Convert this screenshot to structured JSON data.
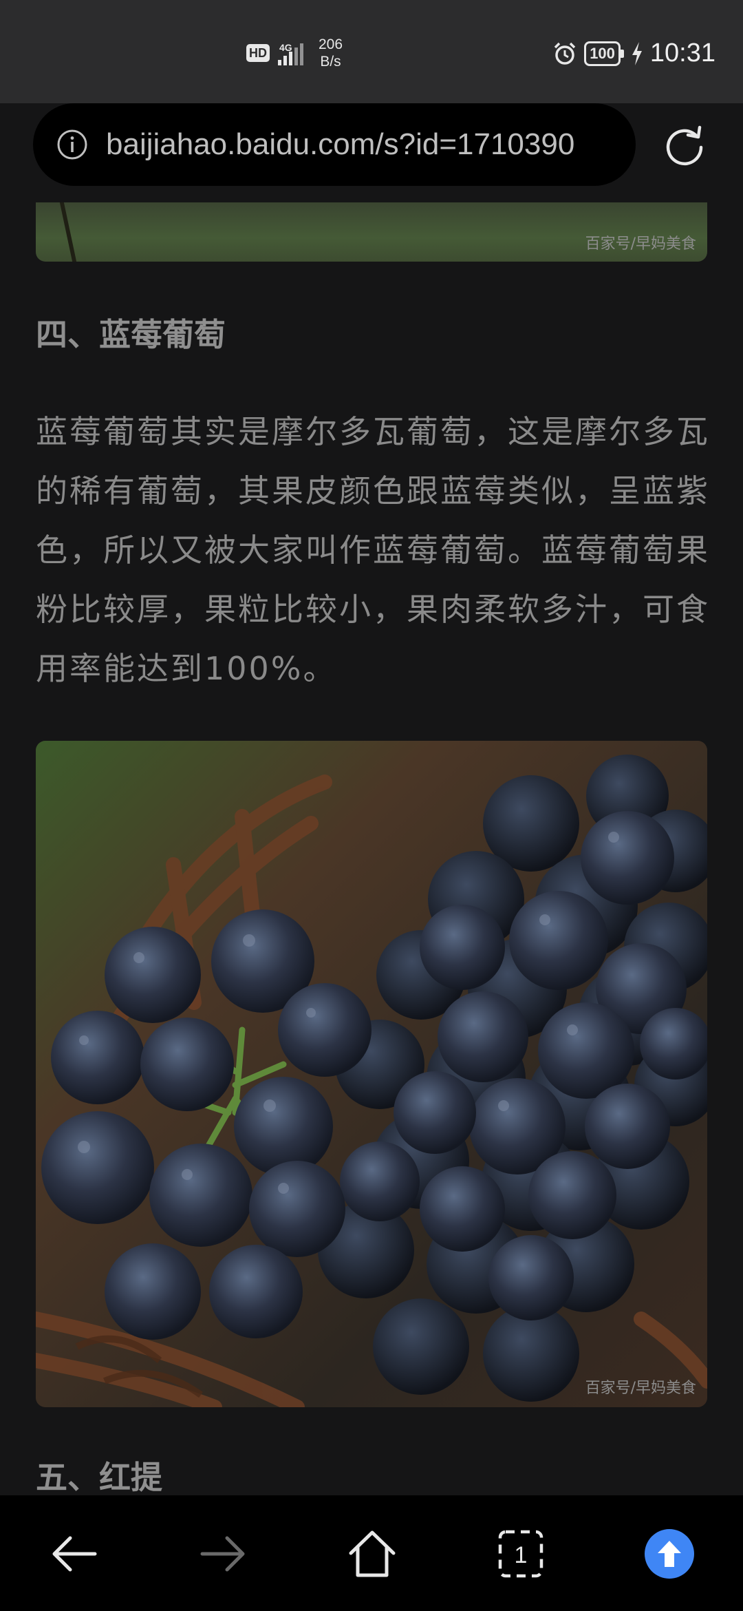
{
  "status_bar": {
    "network_badge": "HD",
    "network_type": "4G",
    "speed_value": "206",
    "speed_unit": "B/s",
    "battery": "100",
    "time": "10:31"
  },
  "address_bar": {
    "url": "baijiahao.baidu.com/s?id=1710390"
  },
  "article": {
    "image_watermark": "百家号/早妈美食",
    "section_four_title": "四、蓝莓葡萄",
    "section_four_body": "蓝莓葡萄其实是摩尔多瓦葡萄，这是摩尔多瓦的稀有葡萄，其果皮颜色跟蓝莓类似，呈蓝紫色，所以又被大家叫作蓝莓葡萄。蓝莓葡萄果粉比较厚，果粒比较小，果肉柔软多汁，可食用率能达到100%。",
    "photo_watermark": "百家号/早妈美食",
    "section_five_title": "五、红提"
  },
  "bottom_nav": {
    "tab_count": "1",
    "accent_color": "#3f86f5"
  }
}
